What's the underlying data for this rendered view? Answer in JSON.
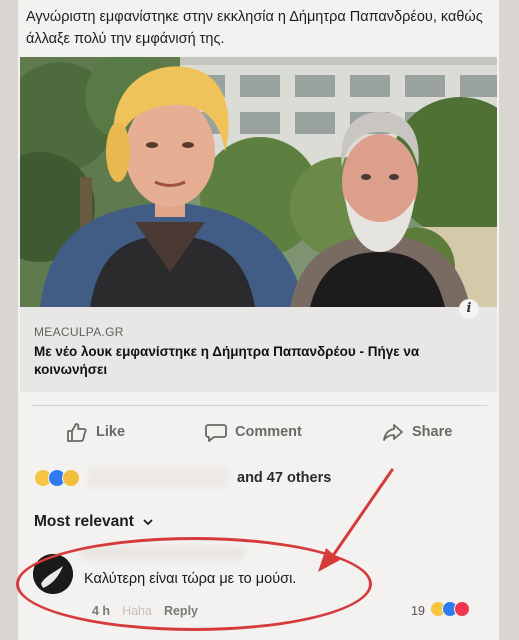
{
  "post": {
    "text": "Αγνώριστη εμφανίστηκε στην εκκλησία η Δήμητρα Παπανδρέου, καθώς άλλαξε πολύ την εμφάνισή της."
  },
  "link": {
    "domain": "MEACULPA.GR",
    "headline": "Με νέο λουκ εμφανίστηκε η Δήμητρα Παπανδρέου - Πήγε να κοινωνήσει",
    "info": "i"
  },
  "actions": {
    "like": "Like",
    "comment": "Comment",
    "share": "Share"
  },
  "reactions": {
    "summary": "and 47 others"
  },
  "comments": {
    "sort_label": "Most relevant",
    "items": [
      {
        "text": "Καλύτερη είναι τώρα με το μούσι.",
        "time": "4 h",
        "reaction_label": "Haha",
        "reply": "Reply",
        "count": "19"
      }
    ]
  },
  "colors": {
    "annotation": "#d53b3b",
    "like_blue": "#2f7cf0"
  }
}
